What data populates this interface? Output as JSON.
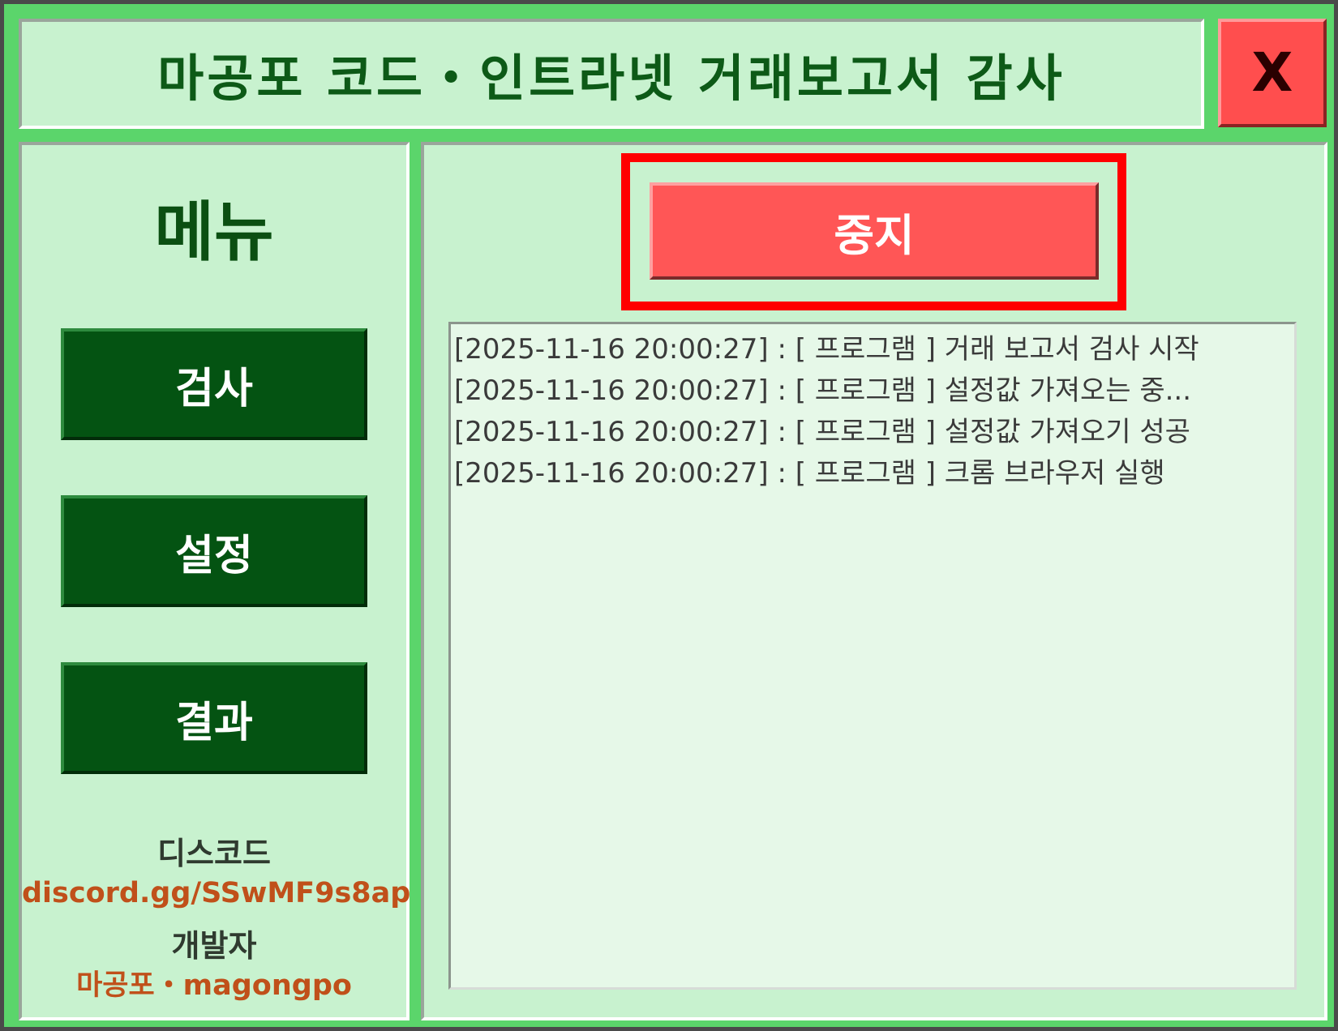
{
  "window": {
    "title": "마공포 코드・인트라넷 거래보고서 감사",
    "close_label": "X"
  },
  "sidebar": {
    "menu_title": "메뉴",
    "items": [
      {
        "label": "검사"
      },
      {
        "label": "설정"
      },
      {
        "label": "결과"
      }
    ],
    "discord_label": "디스코드",
    "discord_link": "discord.gg/SSwMF9s8ap",
    "developer_label": "개발자",
    "developer_name": "마공포・magongpo"
  },
  "main": {
    "stop_label": "중지",
    "log": [
      "[2025-11-16 20:00:27] : [ 프로그램 ] 거래 보고서 검사 시작",
      "[2025-11-16 20:00:27] : [ 프로그램 ] 설정값 가져오는 중...",
      "[2025-11-16 20:00:27] : [ 프로그램 ] 설정값 가져오기 성공",
      "[2025-11-16 20:00:27] : [ 프로그램 ] 크롬 브라우저 실행"
    ]
  },
  "colors": {
    "frame_green": "#5bd56b",
    "panel_green": "#c8f2cf",
    "menu_button": "#045312",
    "stop_button": "#ff5656",
    "close_button": "#ff4e4e",
    "highlight_red": "#ff0000",
    "link_orange": "#c0501a"
  },
  "icons": {
    "close": "x-glyph"
  }
}
